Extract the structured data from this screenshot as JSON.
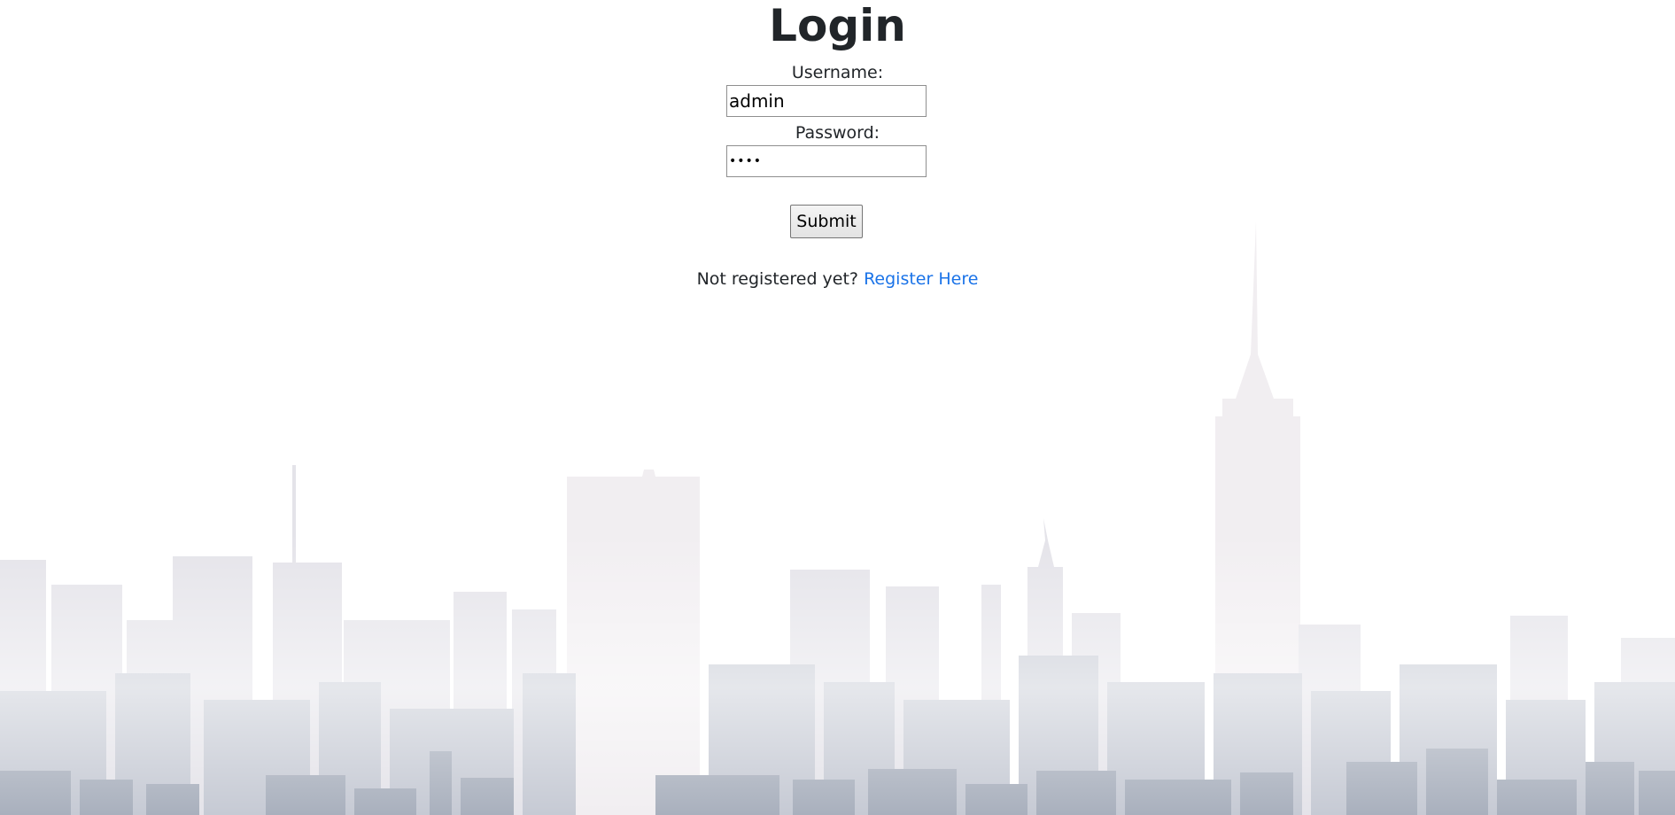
{
  "login": {
    "title": "Login",
    "username_label": "Username:",
    "username_value": "admin",
    "password_label": "Password:",
    "password_value": "adm1",
    "submit_label": "Submit",
    "register_prompt": "Not registered yet?",
    "register_link": "Register Here"
  },
  "background": {
    "icon": "city-skyline-illustration"
  },
  "colors": {
    "text": "#212529",
    "link": "#1a73e8",
    "skyline_light": "#f2eff2",
    "skyline_dark": "#a3abb9"
  }
}
